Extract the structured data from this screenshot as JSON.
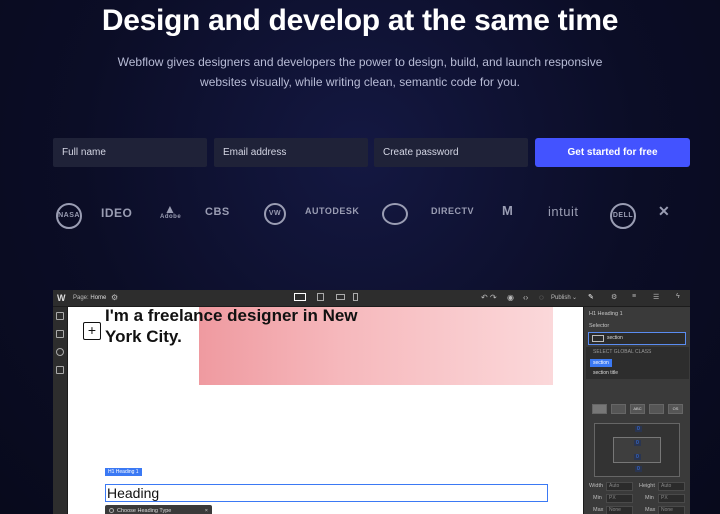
{
  "hero": {
    "title": "Design and develop at the same time",
    "subtitle_line1": "Webflow gives designers and developers the power to design, build, and launch responsive",
    "subtitle_line2": "websites visually, while writing clean, semantic code for you."
  },
  "signup": {
    "full_name_placeholder": "Full name",
    "email_placeholder": "Email address",
    "password_placeholder": "Create password",
    "cta_label": "Get started for free"
  },
  "logos": [
    "NASA",
    "IDEO",
    "Adobe",
    "CBS",
    "VW",
    "AUTODESK",
    "mastercard",
    "DIRECTV",
    "MTV",
    "intuit",
    "DELL",
    "UNDER ARMOUR"
  ],
  "logo_text": {
    "ideo": "IDEO",
    "adobe": "Adobe",
    "cbs": "CBS",
    "vw": "VW",
    "autodesk": "AUTODESK",
    "directv": "DIRECTV",
    "mtv": "M",
    "intuit": "intuit",
    "dell": "DELL",
    "nasa": "NASA"
  },
  "designer": {
    "app_logo": "W",
    "page_prefix": "Page:",
    "page_name": "Home",
    "publish_label": "Publish",
    "canvas": {
      "headline": "I'm a freelance designer in New York City.",
      "add_symbol": "+",
      "element_tag": "H1 Heading 1",
      "heading_text": "Heading",
      "popover_text": "Choose Heading Type",
      "popover_close": "×"
    },
    "panel": {
      "element_label": "H1 Heading 1",
      "selector_label": "Selector",
      "selector_value": "section",
      "dropdown_header": "SELECT GLOBAL CLASS",
      "options": [
        "section",
        "section title"
      ],
      "display_buttons": [
        "",
        "",
        "ABC",
        "",
        "OS"
      ],
      "width_label": "Width",
      "height_label": "Height",
      "min_label": "Min",
      "max_label": "Max",
      "auto_value": "Auto",
      "px_value": "PX",
      "none_value": "None"
    }
  },
  "colors": {
    "background": "#0b0d26",
    "cta": "#4353ff",
    "selection": "#3b79f4",
    "field": "#1f2238"
  }
}
